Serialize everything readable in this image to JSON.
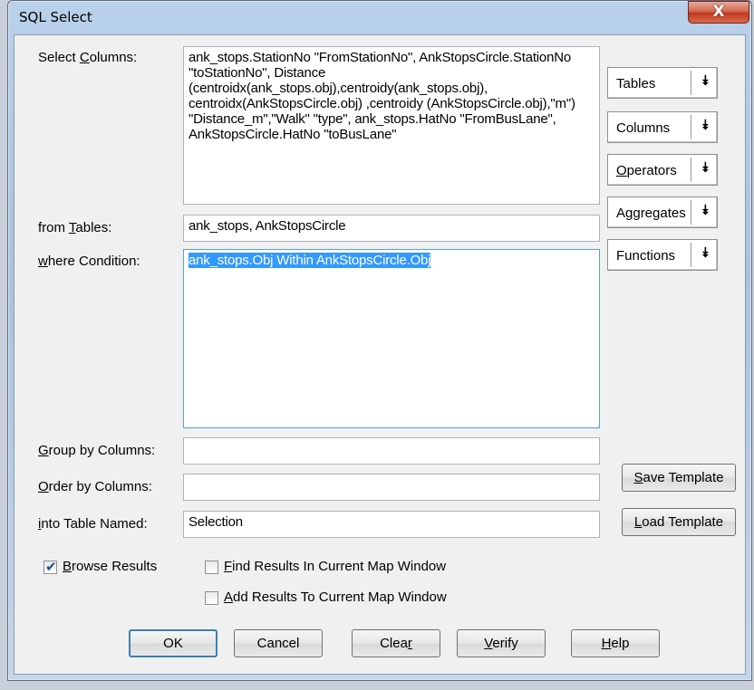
{
  "window": {
    "title": "SQL Select",
    "close_glyph": "X"
  },
  "labels": {
    "select_columns": [
      "Select ",
      "C",
      "olumns:"
    ],
    "from_tables": [
      "from ",
      "T",
      "ables:"
    ],
    "where_condition": [
      "",
      "w",
      "here Condition:"
    ],
    "group_by": [
      "",
      "G",
      "roup by Columns:"
    ],
    "order_by": [
      "",
      "O",
      "rder by Columns:"
    ],
    "into_table": [
      "",
      "i",
      "nto Table Named:"
    ]
  },
  "fields": {
    "select_columns": "ank_stops.StationNo \"FromStationNo\", AnkStopsCircle.StationNo \"toStationNo\", Distance (centroidx(ank_stops.obj),centroidy(ank_stops.obj), centroidx(AnkStopsCircle.obj) ,centroidy (AnkStopsCircle.obj),\"m\") \"Distance_m\",\"Walk\" \"type\", ank_stops.HatNo \"FromBusLane\", AnkStopsCircle.HatNo \"toBusLane\"",
    "from_tables": "ank_stops, AnkStopsCircle",
    "where_condition": "ank_stops.Obj Within AnkStopsCircle.Obj",
    "group_by": "",
    "order_by": "",
    "into_table": "Selection"
  },
  "dropdowns": {
    "tables": "Tables",
    "columns": "Columns",
    "operators": [
      "",
      "O",
      "perators"
    ],
    "aggregates": "Aggregates",
    "functions": "Functions",
    "arrow_glyph": "⯯"
  },
  "side_buttons": {
    "save_template": [
      "",
      "S",
      "ave Template"
    ],
    "load_template": [
      "",
      "L",
      "oad Template"
    ]
  },
  "checkboxes": {
    "browse_results": {
      "label": [
        "",
        "B",
        "rowse Results"
      ],
      "checked": true
    },
    "find_results": {
      "label": [
        "",
        "F",
        "ind Results In Current Map Window"
      ],
      "checked": false
    },
    "add_results": {
      "label": [
        "",
        "A",
        "dd Results To Current Map Window"
      ],
      "checked": false
    }
  },
  "buttons": {
    "ok": "OK",
    "cancel": "Cancel",
    "clear": [
      "Clea",
      "r",
      ""
    ],
    "verify": [
      "",
      "V",
      "erify"
    ],
    "help": [
      "",
      "H",
      "elp"
    ]
  },
  "colors": {
    "selection_highlight": "#3399ff",
    "close_button": "#c0391e",
    "dialog_bg": "#f0f0f0"
  }
}
